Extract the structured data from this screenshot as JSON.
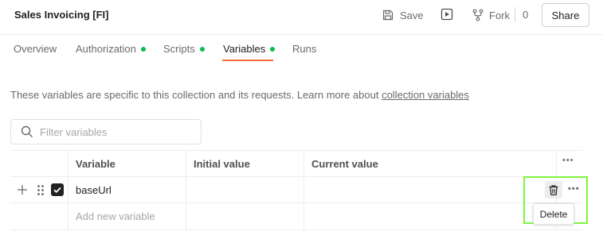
{
  "header": {
    "title": "Sales Invoicing [FI]",
    "save_label": "Save",
    "fork_label": "Fork",
    "fork_count": "0",
    "share_label": "Share"
  },
  "tabs": [
    {
      "label": "Overview",
      "has_dot": false,
      "active": false
    },
    {
      "label": "Authorization",
      "has_dot": true,
      "active": false
    },
    {
      "label": "Scripts",
      "has_dot": true,
      "active": false
    },
    {
      "label": "Variables",
      "has_dot": true,
      "active": true
    },
    {
      "label": "Runs",
      "has_dot": false,
      "active": false
    }
  ],
  "description": {
    "text": "These variables are specific to this collection and its requests. Learn more about ",
    "link": "collection variables"
  },
  "filter": {
    "placeholder": "Filter variables",
    "value": ""
  },
  "table": {
    "columns": [
      "Variable",
      "Initial value",
      "Current value"
    ],
    "rows": [
      {
        "variable": "baseUrl",
        "initial_value": "",
        "current_value": "",
        "enabled": true
      }
    ],
    "new_row_placeholder": "Add new variable"
  },
  "row_actions": {
    "tooltip": "Delete",
    "icon": "trash-icon"
  },
  "colors": {
    "accent": "#ff6c37",
    "dot": "#0cbb52",
    "highlight": "#7ef53a"
  }
}
